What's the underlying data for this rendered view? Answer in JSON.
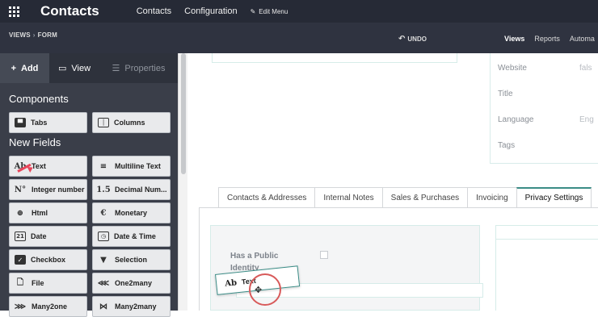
{
  "navbar": {
    "app_title": "Contacts",
    "menu": [
      "Contacts",
      "Configuration"
    ],
    "edit_menu": "Edit Menu"
  },
  "subbar": {
    "crumb_1": "VIEWS",
    "crumb_2": "FORM",
    "undo": "UNDO",
    "right_tabs": [
      "Views",
      "Reports",
      "Automa"
    ]
  },
  "sidebar": {
    "tabs": {
      "add": "Add",
      "view": "View",
      "properties": "Properties"
    },
    "components_title": "Components",
    "components": [
      {
        "icon": "tabs-icon",
        "label": "Tabs"
      },
      {
        "icon": "columns-icon",
        "label": "Columns"
      }
    ],
    "new_fields_title": "New Fields",
    "fields": [
      {
        "icon": "text-icon",
        "glyph": "Ab",
        "label": "Text"
      },
      {
        "icon": "multiline-text-icon",
        "glyph": "≡",
        "label": "Multiline Text"
      },
      {
        "icon": "integer-icon",
        "glyph": "N°",
        "label": "Integer number"
      },
      {
        "icon": "decimal-icon",
        "glyph": "1.5",
        "label": "Decimal Num..."
      },
      {
        "icon": "html-icon",
        "glyph": "⊕",
        "label": "Html"
      },
      {
        "icon": "monetary-icon",
        "glyph": "€",
        "label": "Monetary"
      },
      {
        "icon": "date-icon",
        "glyph": "21",
        "label": "Date"
      },
      {
        "icon": "datetime-icon",
        "glyph": "◷",
        "label": "Date & Time"
      },
      {
        "icon": "checkbox-icon",
        "glyph": "✓",
        "label": "Checkbox"
      },
      {
        "icon": "selection-icon",
        "glyph": "▼",
        "label": "Selection"
      },
      {
        "icon": "file-icon",
        "glyph": "🗋",
        "label": "File"
      },
      {
        "icon": "one2many-icon",
        "glyph": "⋘",
        "label": "One2many"
      },
      {
        "icon": "many2one-icon",
        "glyph": "⋙",
        "label": "Many2one"
      },
      {
        "icon": "many2many-icon",
        "glyph": "⋈",
        "label": "Many2many"
      }
    ]
  },
  "form": {
    "right_fields": [
      {
        "label": "Website",
        "value": "fals"
      },
      {
        "label": "Title",
        "value": ""
      },
      {
        "label": "Language",
        "value": "Eng"
      },
      {
        "label": "Tags",
        "value": ""
      }
    ],
    "notebook_tabs": [
      "Contacts & Addresses",
      "Internal Notes",
      "Sales & Purchases",
      "Invoicing",
      "Privacy Settings"
    ],
    "active_tab": "Privacy Settings",
    "public_identity_label": "Has a Public Identity"
  },
  "drag": {
    "glyph": "Ab",
    "label": "Text"
  },
  "colors": {
    "navbar": "#262a36",
    "sidebar": "#3a3e49",
    "accent": "#3b8c86",
    "pointer": "#e8455a"
  }
}
